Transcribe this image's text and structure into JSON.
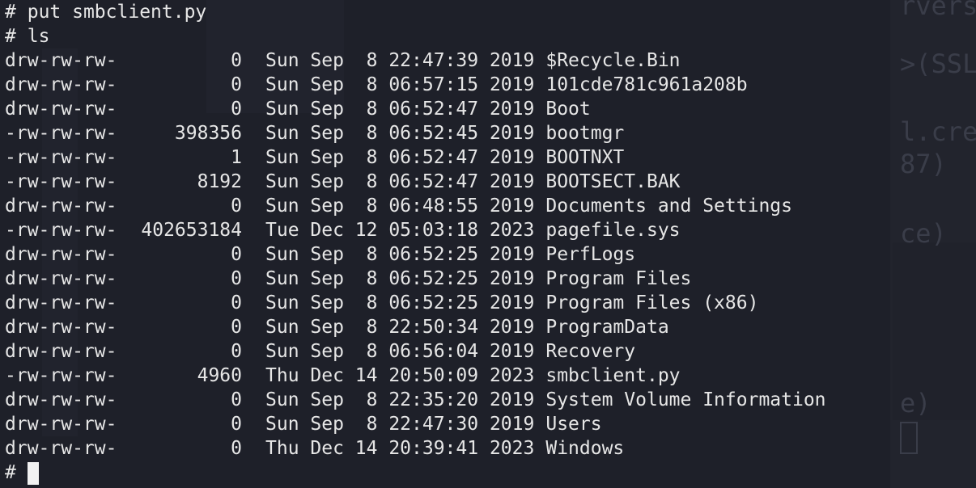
{
  "commands": {
    "prompt": "#",
    "put_cmd": "put smbclient.py",
    "ls_cmd": "ls"
  },
  "files": [
    {
      "perm": "drw-rw-rw-",
      "size": "0",
      "date": "Sun Sep  8 22:47:39 2019",
      "name": "$Recycle.Bin"
    },
    {
      "perm": "drw-rw-rw-",
      "size": "0",
      "date": "Sun Sep  8 06:57:15 2019",
      "name": "101cde781c961a208b"
    },
    {
      "perm": "drw-rw-rw-",
      "size": "0",
      "date": "Sun Sep  8 06:52:47 2019",
      "name": "Boot"
    },
    {
      "perm": "-rw-rw-rw-",
      "size": "398356",
      "date": "Sun Sep  8 06:52:45 2019",
      "name": "bootmgr"
    },
    {
      "perm": "-rw-rw-rw-",
      "size": "1",
      "date": "Sun Sep  8 06:52:47 2019",
      "name": "BOOTNXT"
    },
    {
      "perm": "-rw-rw-rw-",
      "size": "8192",
      "date": "Sun Sep  8 06:52:47 2019",
      "name": "BOOTSECT.BAK"
    },
    {
      "perm": "drw-rw-rw-",
      "size": "0",
      "date": "Sun Sep  8 06:48:55 2019",
      "name": "Documents and Settings"
    },
    {
      "perm": "-rw-rw-rw-",
      "size": "402653184",
      "date": "Tue Dec 12 05:03:18 2023",
      "name": "pagefile.sys"
    },
    {
      "perm": "drw-rw-rw-",
      "size": "0",
      "date": "Sun Sep  8 06:52:25 2019",
      "name": "PerfLogs"
    },
    {
      "perm": "drw-rw-rw-",
      "size": "0",
      "date": "Sun Sep  8 06:52:25 2019",
      "name": "Program Files"
    },
    {
      "perm": "drw-rw-rw-",
      "size": "0",
      "date": "Sun Sep  8 06:52:25 2019",
      "name": "Program Files (x86)"
    },
    {
      "perm": "drw-rw-rw-",
      "size": "0",
      "date": "Sun Sep  8 22:50:34 2019",
      "name": "ProgramData"
    },
    {
      "perm": "drw-rw-rw-",
      "size": "0",
      "date": "Sun Sep  8 06:56:04 2019",
      "name": "Recovery"
    },
    {
      "perm": "-rw-rw-rw-",
      "size": "4960",
      "date": "Thu Dec 14 20:50:09 2023",
      "name": "smbclient.py"
    },
    {
      "perm": "drw-rw-rw-",
      "size": "0",
      "date": "Sun Sep  8 22:35:20 2019",
      "name": "System Volume Information"
    },
    {
      "perm": "drw-rw-rw-",
      "size": "0",
      "date": "Sun Sep  8 22:47:30 2019",
      "name": "Users"
    },
    {
      "perm": "drw-rw-rw-",
      "size": "0",
      "date": "Thu Dec 14 20:39:41 2023",
      "name": "Windows"
    }
  ],
  "background_ghost": {
    "texts": [
      "rvers",
      ">(SSL",
      "l.cre",
      "87)",
      "ce)",
      "e)"
    ]
  },
  "colors": {
    "background": "#1e2029",
    "foreground": "#e6e6e6",
    "cursor": "#f2f2f2"
  }
}
